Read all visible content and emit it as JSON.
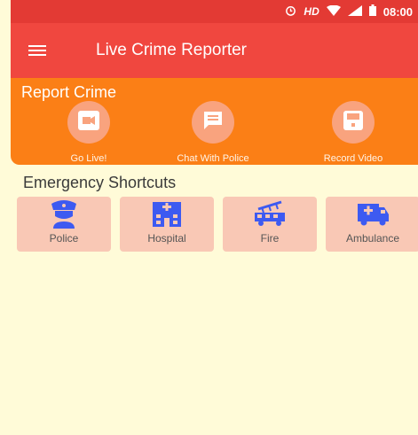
{
  "status_bar": {
    "time": "08:00",
    "hd_label": "HD",
    "icons": [
      "alarm-icon",
      "wifi-icon",
      "lte-signal-icon",
      "battery-icon"
    ]
  },
  "app_bar": {
    "title": "Live Crime Reporter",
    "menu_icon": "menu-icon"
  },
  "report": {
    "title": "Report Crime",
    "actions": [
      {
        "label": "Go Live!",
        "icon": "video-camera-icon"
      },
      {
        "label": "Chat With Police",
        "icon": "chat-icon"
      },
      {
        "label": "Record Video",
        "icon": "save-record-icon"
      }
    ]
  },
  "emergency": {
    "title": "Emergency Shortcuts",
    "shortcuts": [
      {
        "label": "Police",
        "icon": "police-icon"
      },
      {
        "label": "Hospital",
        "icon": "hospital-icon"
      },
      {
        "label": "Fire",
        "icon": "fire-truck-icon"
      },
      {
        "label": "Ambulance",
        "icon": "ambulance-icon"
      }
    ]
  },
  "colors": {
    "status_bar": "#e33a34",
    "app_bar": "#f0473f",
    "report_card": "#fb7f16",
    "action_circle": "#f9a37e",
    "shortcut_tile": "#f9c8b5",
    "shortcut_icon": "#3d5af1",
    "background": "#fffbd8"
  }
}
